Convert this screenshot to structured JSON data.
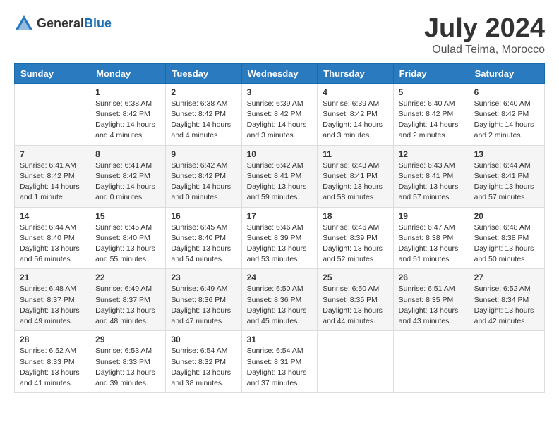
{
  "logo": {
    "text_general": "General",
    "text_blue": "Blue"
  },
  "title": {
    "month_year": "July 2024",
    "location": "Oulad Teima, Morocco"
  },
  "weekdays": [
    "Sunday",
    "Monday",
    "Tuesday",
    "Wednesday",
    "Thursday",
    "Friday",
    "Saturday"
  ],
  "weeks": [
    [
      {
        "day": "",
        "info": ""
      },
      {
        "day": "1",
        "info": "Sunrise: 6:38 AM\nSunset: 8:42 PM\nDaylight: 14 hours\nand 4 minutes."
      },
      {
        "day": "2",
        "info": "Sunrise: 6:38 AM\nSunset: 8:42 PM\nDaylight: 14 hours\nand 4 minutes."
      },
      {
        "day": "3",
        "info": "Sunrise: 6:39 AM\nSunset: 8:42 PM\nDaylight: 14 hours\nand 3 minutes."
      },
      {
        "day": "4",
        "info": "Sunrise: 6:39 AM\nSunset: 8:42 PM\nDaylight: 14 hours\nand 3 minutes."
      },
      {
        "day": "5",
        "info": "Sunrise: 6:40 AM\nSunset: 8:42 PM\nDaylight: 14 hours\nand 2 minutes."
      },
      {
        "day": "6",
        "info": "Sunrise: 6:40 AM\nSunset: 8:42 PM\nDaylight: 14 hours\nand 2 minutes."
      }
    ],
    [
      {
        "day": "7",
        "info": "Sunrise: 6:41 AM\nSunset: 8:42 PM\nDaylight: 14 hours\nand 1 minute."
      },
      {
        "day": "8",
        "info": "Sunrise: 6:41 AM\nSunset: 8:42 PM\nDaylight: 14 hours\nand 0 minutes."
      },
      {
        "day": "9",
        "info": "Sunrise: 6:42 AM\nSunset: 8:42 PM\nDaylight: 14 hours\nand 0 minutes."
      },
      {
        "day": "10",
        "info": "Sunrise: 6:42 AM\nSunset: 8:41 PM\nDaylight: 13 hours\nand 59 minutes."
      },
      {
        "day": "11",
        "info": "Sunrise: 6:43 AM\nSunset: 8:41 PM\nDaylight: 13 hours\nand 58 minutes."
      },
      {
        "day": "12",
        "info": "Sunrise: 6:43 AM\nSunset: 8:41 PM\nDaylight: 13 hours\nand 57 minutes."
      },
      {
        "day": "13",
        "info": "Sunrise: 6:44 AM\nSunset: 8:41 PM\nDaylight: 13 hours\nand 57 minutes."
      }
    ],
    [
      {
        "day": "14",
        "info": "Sunrise: 6:44 AM\nSunset: 8:40 PM\nDaylight: 13 hours\nand 56 minutes."
      },
      {
        "day": "15",
        "info": "Sunrise: 6:45 AM\nSunset: 8:40 PM\nDaylight: 13 hours\nand 55 minutes."
      },
      {
        "day": "16",
        "info": "Sunrise: 6:45 AM\nSunset: 8:40 PM\nDaylight: 13 hours\nand 54 minutes."
      },
      {
        "day": "17",
        "info": "Sunrise: 6:46 AM\nSunset: 8:39 PM\nDaylight: 13 hours\nand 53 minutes."
      },
      {
        "day": "18",
        "info": "Sunrise: 6:46 AM\nSunset: 8:39 PM\nDaylight: 13 hours\nand 52 minutes."
      },
      {
        "day": "19",
        "info": "Sunrise: 6:47 AM\nSunset: 8:38 PM\nDaylight: 13 hours\nand 51 minutes."
      },
      {
        "day": "20",
        "info": "Sunrise: 6:48 AM\nSunset: 8:38 PM\nDaylight: 13 hours\nand 50 minutes."
      }
    ],
    [
      {
        "day": "21",
        "info": "Sunrise: 6:48 AM\nSunset: 8:37 PM\nDaylight: 13 hours\nand 49 minutes."
      },
      {
        "day": "22",
        "info": "Sunrise: 6:49 AM\nSunset: 8:37 PM\nDaylight: 13 hours\nand 48 minutes."
      },
      {
        "day": "23",
        "info": "Sunrise: 6:49 AM\nSunset: 8:36 PM\nDaylight: 13 hours\nand 47 minutes."
      },
      {
        "day": "24",
        "info": "Sunrise: 6:50 AM\nSunset: 8:36 PM\nDaylight: 13 hours\nand 45 minutes."
      },
      {
        "day": "25",
        "info": "Sunrise: 6:50 AM\nSunset: 8:35 PM\nDaylight: 13 hours\nand 44 minutes."
      },
      {
        "day": "26",
        "info": "Sunrise: 6:51 AM\nSunset: 8:35 PM\nDaylight: 13 hours\nand 43 minutes."
      },
      {
        "day": "27",
        "info": "Sunrise: 6:52 AM\nSunset: 8:34 PM\nDaylight: 13 hours\nand 42 minutes."
      }
    ],
    [
      {
        "day": "28",
        "info": "Sunrise: 6:52 AM\nSunset: 8:33 PM\nDaylight: 13 hours\nand 41 minutes."
      },
      {
        "day": "29",
        "info": "Sunrise: 6:53 AM\nSunset: 8:33 PM\nDaylight: 13 hours\nand 39 minutes."
      },
      {
        "day": "30",
        "info": "Sunrise: 6:54 AM\nSunset: 8:32 PM\nDaylight: 13 hours\nand 38 minutes."
      },
      {
        "day": "31",
        "info": "Sunrise: 6:54 AM\nSunset: 8:31 PM\nDaylight: 13 hours\nand 37 minutes."
      },
      {
        "day": "",
        "info": ""
      },
      {
        "day": "",
        "info": ""
      },
      {
        "day": "",
        "info": ""
      }
    ]
  ]
}
